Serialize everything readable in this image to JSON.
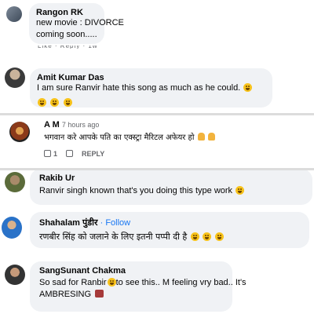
{
  "comments": [
    {
      "author": "Rangon RK",
      "lines": [
        "new movie : DIVORCE",
        "coming soon....."
      ]
    },
    {
      "author": "Amit Kumar Das",
      "text": "I am sure Ranvir hate this song as much as he could."
    },
    {
      "author": "A M",
      "time": "7 hours ago",
      "text": "भगवान करे आपके पति का एक्स्ट्रा मैरिटल अफेयर हो",
      "actions": {
        "like_count": "1",
        "reply": "REPLY"
      }
    },
    {
      "author": "Rakib Ur",
      "text": "Ranvir singh known that's you doing this type work"
    },
    {
      "author": "Shahalam पुंडीर",
      "follow": "Follow",
      "text": "रणबीर सिंह को जलाने के लिए इतनी पप्पी दी है"
    },
    {
      "author": "SangSunant Chakma",
      "lines": [
        "So sad for Ranbir",
        "to see this.. M feeling vry bad.. It's",
        "AMBRESING"
      ]
    }
  ],
  "colors": {
    "bubble": "#f0f2f5",
    "link": "#1877f2",
    "meta": "#65676b"
  }
}
